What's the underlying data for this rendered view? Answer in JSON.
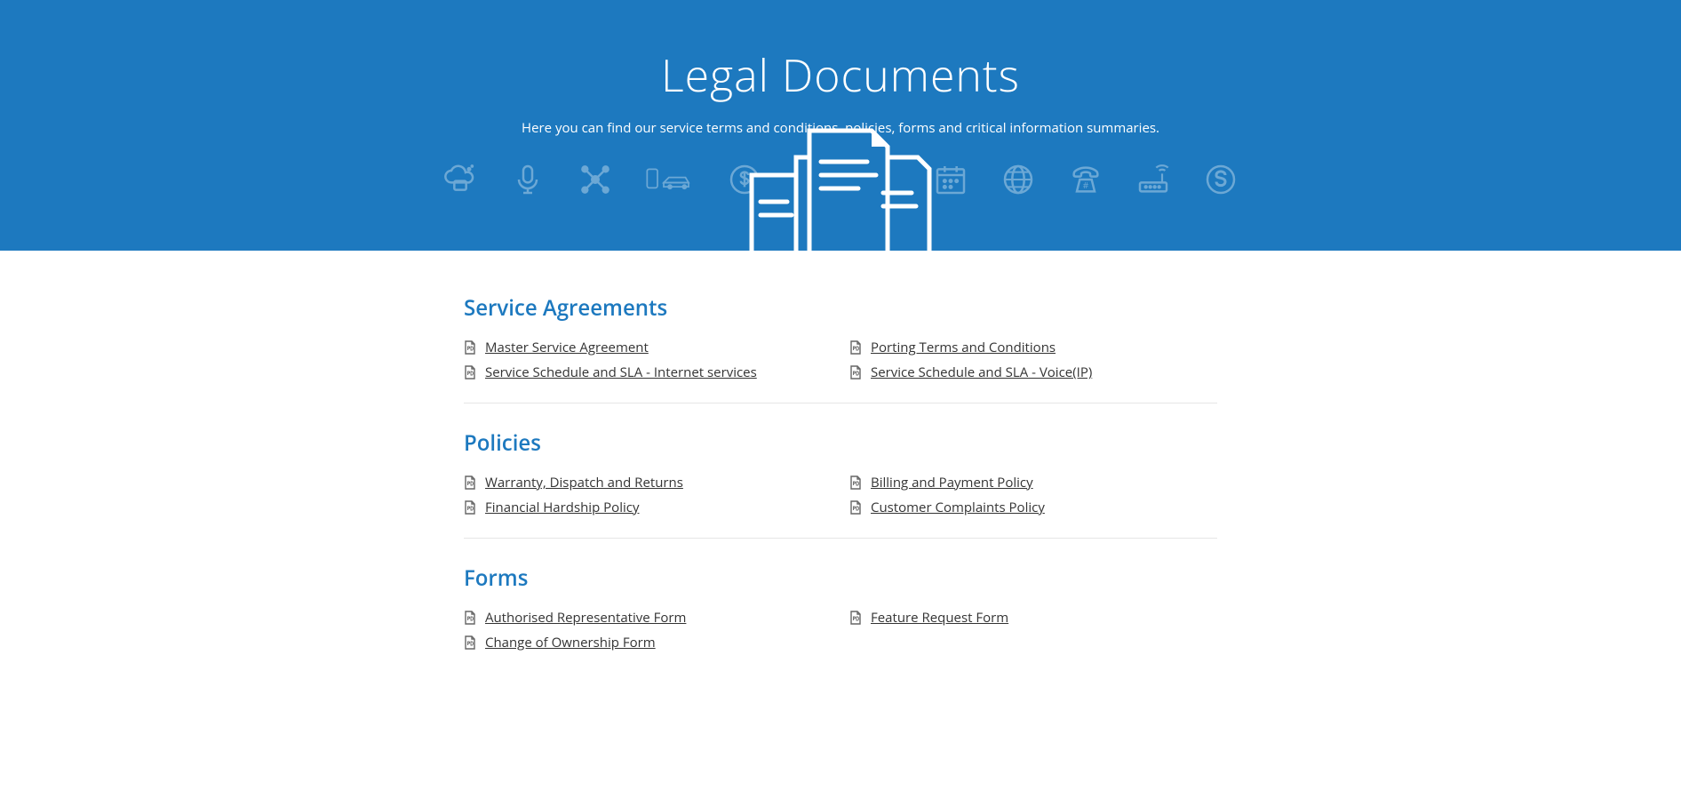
{
  "hero": {
    "title": "Legal Documents",
    "subtitle": "Here you can find our service terms and conditions, policies, forms and critical information summaries."
  },
  "sections": [
    {
      "heading": "Service Agreements",
      "links": [
        {
          "label": "Master Service Agreement"
        },
        {
          "label": "Porting Terms and Conditions"
        },
        {
          "label": "Service Schedule and SLA - Internet services"
        },
        {
          "label": "Service Schedule and SLA - Voice(IP)"
        }
      ]
    },
    {
      "heading": "Policies",
      "links": [
        {
          "label": "Warranty, Dispatch and Returns"
        },
        {
          "label": "Billing and Payment Policy"
        },
        {
          "label": "Financial Hardship Policy"
        },
        {
          "label": "Customer Complaints Policy"
        }
      ]
    },
    {
      "heading": "Forms",
      "links": [
        {
          "label": "Authorised Representative Form"
        },
        {
          "label": "Feature Request Form"
        },
        {
          "label": "Change of Ownership Form"
        }
      ]
    }
  ]
}
